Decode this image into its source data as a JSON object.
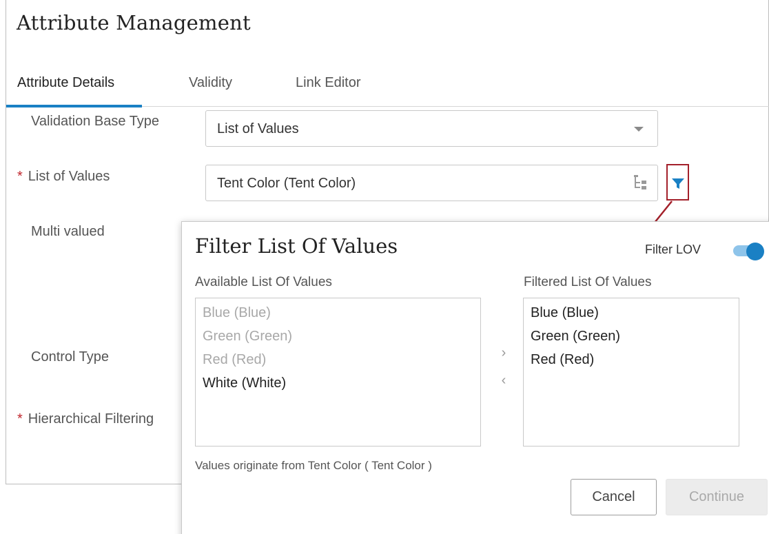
{
  "panel": {
    "title": "Attribute Management",
    "tabs": [
      {
        "label": "Attribute Details",
        "active": true
      },
      {
        "label": "Validity",
        "active": false
      },
      {
        "label": "Link Editor",
        "active": false
      }
    ],
    "fields": {
      "validation_base_type": {
        "label": "Validation Base Type",
        "value": "List of Values"
      },
      "list_of_values": {
        "label": "List of Values",
        "required": "*",
        "value": "Tent Color (Tent Color)"
      },
      "multi_valued": {
        "label": "Multi valued"
      },
      "control_type": {
        "label": "Control Type"
      },
      "hierarchical_filtering": {
        "label": "Hierarchical Filtering",
        "required": "*"
      }
    },
    "filter_icon": "filter-icon",
    "accent_color": "#1a80c4",
    "highlight_color": "#a3202a"
  },
  "dialog": {
    "title": "Filter List Of Values",
    "toggle_label": "Filter LOV",
    "toggle_on": true,
    "available_heading": "Available List Of Values",
    "filtered_heading": "Filtered List Of Values",
    "available_items": [
      {
        "label": "Blue (Blue)",
        "state": "dimmed"
      },
      {
        "label": "Green (Green)",
        "state": "dimmed"
      },
      {
        "label": "Red (Red)",
        "state": "dimmed"
      },
      {
        "label": "White (White)",
        "state": "normal"
      }
    ],
    "filtered_items": [
      {
        "label": "Blue (Blue)"
      },
      {
        "label": "Green (Green)"
      },
      {
        "label": "Red (Red)"
      }
    ],
    "move_right_glyph": "›",
    "move_left_glyph": "‹",
    "footnote": "Values originate from Tent Color ( Tent Color )",
    "cancel_label": "Cancel",
    "continue_label": "Continue"
  }
}
